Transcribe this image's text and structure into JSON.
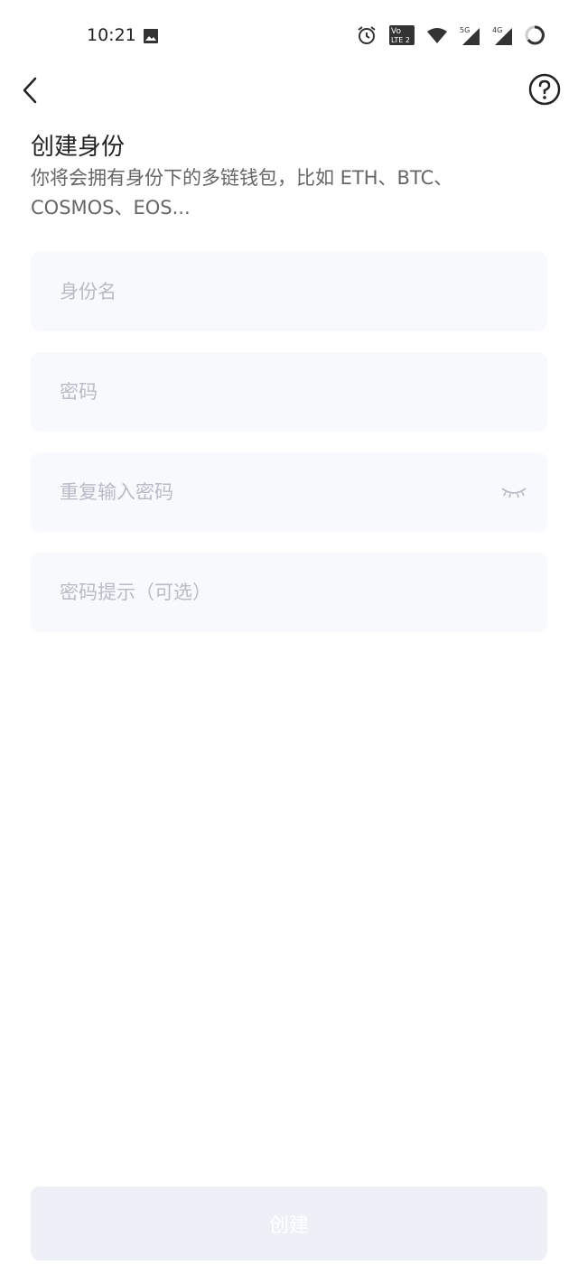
{
  "status_bar": {
    "time": "10:21",
    "icons": [
      "image-icon",
      "alarm-icon",
      "volte-lte-icon",
      "wifi-icon",
      "signal-5g-icon",
      "signal-4g-icon",
      "battery-icon"
    ],
    "net_volte": "Vo",
    "net_lte": "LTE 2",
    "net_5g": "5G",
    "net_4g": "4G"
  },
  "nav": {
    "back_icon": "chevron-left-icon",
    "help_icon": "question-circle-icon"
  },
  "header": {
    "title": "创建身份",
    "subtitle": "你将会拥有身份下的多链钱包，比如 ETH、BTC、COSMOS、EOS..."
  },
  "form": {
    "identity_name": {
      "placeholder": "身份名",
      "value": ""
    },
    "password": {
      "placeholder": "密码",
      "value": ""
    },
    "repeat_password": {
      "placeholder": "重复输入密码",
      "value": "",
      "toggle_icon": "eye-closed-icon"
    },
    "password_hint": {
      "placeholder": "密码提示（可选）",
      "value": ""
    }
  },
  "actions": {
    "create_label": "创建"
  },
  "colors": {
    "field_bg": "#f8f9fc",
    "placeholder": "#b8bcc8",
    "button_bg_disabled": "#eef0f8",
    "button_text": "#ffffff",
    "subtitle": "#666666"
  }
}
